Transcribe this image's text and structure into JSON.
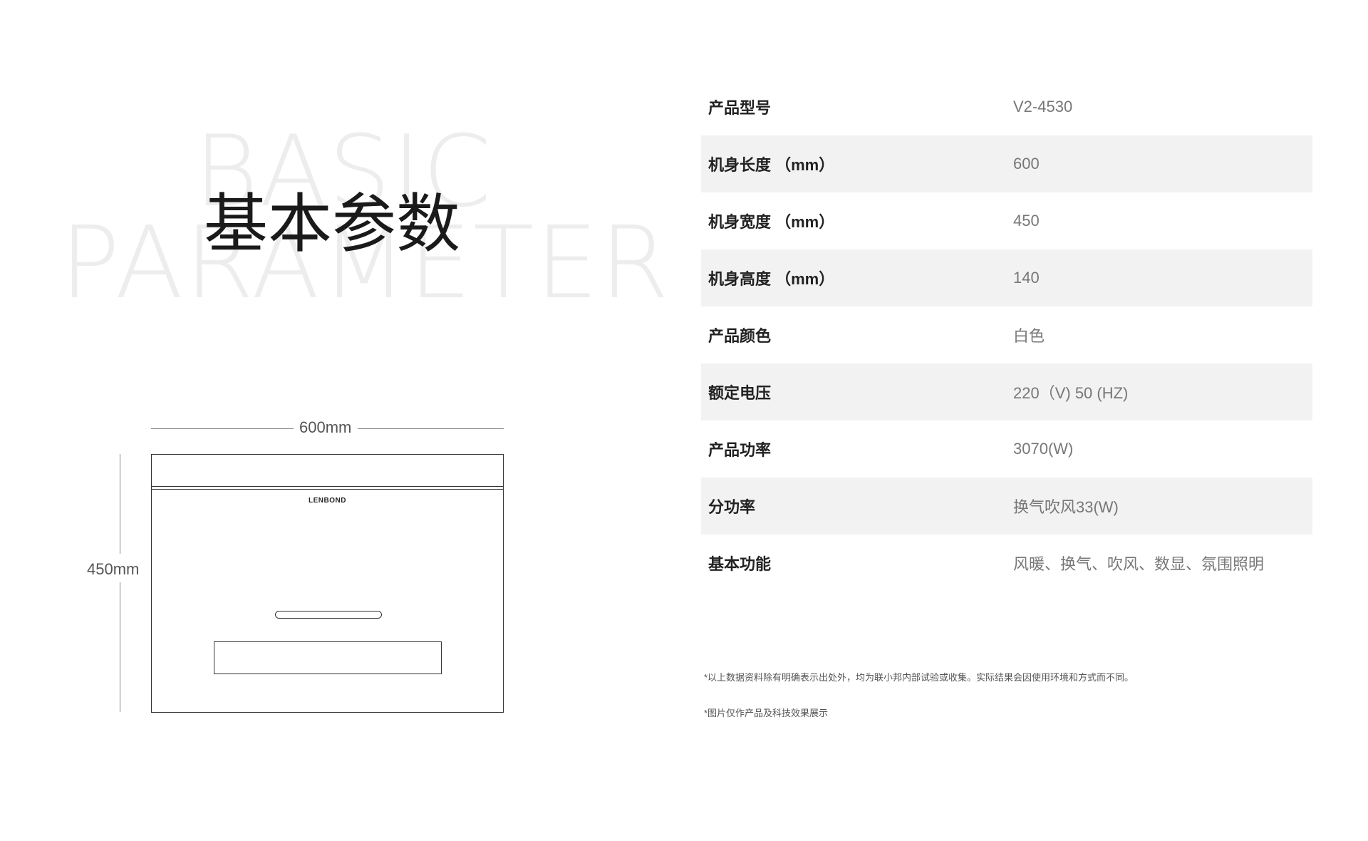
{
  "background_words": {
    "line1": "BASIC",
    "line2": "PARAMETER"
  },
  "title": "基本参数",
  "diagram": {
    "width_label": "600mm",
    "height_label": "450mm",
    "brand": "LENBOND"
  },
  "specs": [
    {
      "label": "产品型号",
      "value": "V2-4530"
    },
    {
      "label": "机身长度 （mm）",
      "value": "600"
    },
    {
      "label": "机身宽度 （mm）",
      "value": "450"
    },
    {
      "label": "机身高度 （mm）",
      "value": "140"
    },
    {
      "label": "产品颜色",
      "value": "白色"
    },
    {
      "label": "额定电压",
      "value": "220（V) 50 (HZ)"
    },
    {
      "label": "产品功率",
      "value": "3070(W)"
    },
    {
      "label": "分功率",
      "value": "换气吹风33(W)"
    },
    {
      "label": "基本功能",
      "value": "风暖、换气、吹风、数显、氛围照明"
    }
  ],
  "notes": {
    "disclaimer": "*以上数据资料除有明确表示出处外，均为联小邦内部试验或收集。实际结果会因使用环境和方式而不同。",
    "image_note": "*图片仅作产品及科技效果展示"
  }
}
